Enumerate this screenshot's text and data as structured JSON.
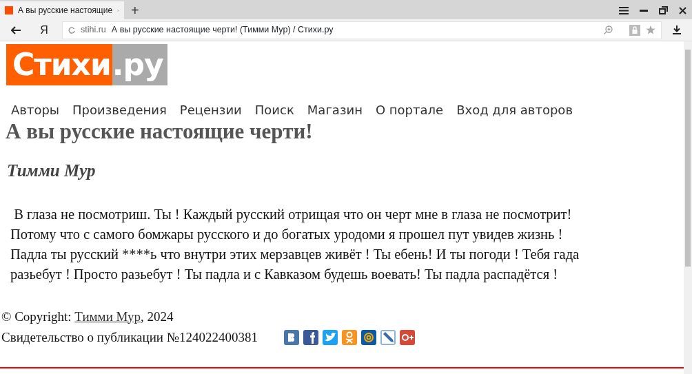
{
  "browser": {
    "tab": {
      "title": "А вы русские настоящие",
      "selected": true
    },
    "new_tab": "+",
    "home_button": "Я",
    "address": {
      "domain": "stihi.ru",
      "title": "А вы русские настоящие черти! (Тимми Мур) / Стихи.ру"
    }
  },
  "logo": {
    "left": "Стихи",
    "right": ".ру"
  },
  "nav": [
    "Авторы",
    "Произведения",
    "Рецензии",
    "Поиск",
    "Магазин",
    "О портале",
    "Вход для авторов"
  ],
  "poem": {
    "title": "А вы русские настоящие черти!",
    "author": "Тимми Мур",
    "lines": [
      " В глаза не посмотриш. Ты ! Каждый русский отрищая что он черт мне в глаза не посмотрит!",
      "Потому что с самого бомжары русского и до богатых уродоми я прошел пут увидев жизнь !",
      "Падла ты русский ****ь что внутри этих мерзавцев живёт ! Ты ебень! И ты погоди ! Тебя гада",
      "разьебут ! Просто разьебут ! Ты падла и с Кавказом будешь воевать! Ты падла распадётся !"
    ]
  },
  "footer": {
    "copyright_prefix": "© Copyright: ",
    "author_link": "Тимми Мур",
    "copyright_suffix": ", 2024",
    "certificate": "Свидетельство о публикации №124022400381",
    "share": [
      {
        "kind": "vk",
        "color": "#4a76a8"
      },
      {
        "kind": "fb",
        "color": "#3b5998"
      },
      {
        "kind": "tw",
        "color": "#1da1f2"
      },
      {
        "kind": "ok",
        "color": "#f7931e"
      },
      {
        "kind": "mail",
        "color": "#0a5aa8"
      },
      {
        "kind": "lj",
        "color": "#8fb4da"
      },
      {
        "kind": "gplus",
        "color": "#d64937"
      }
    ]
  }
}
